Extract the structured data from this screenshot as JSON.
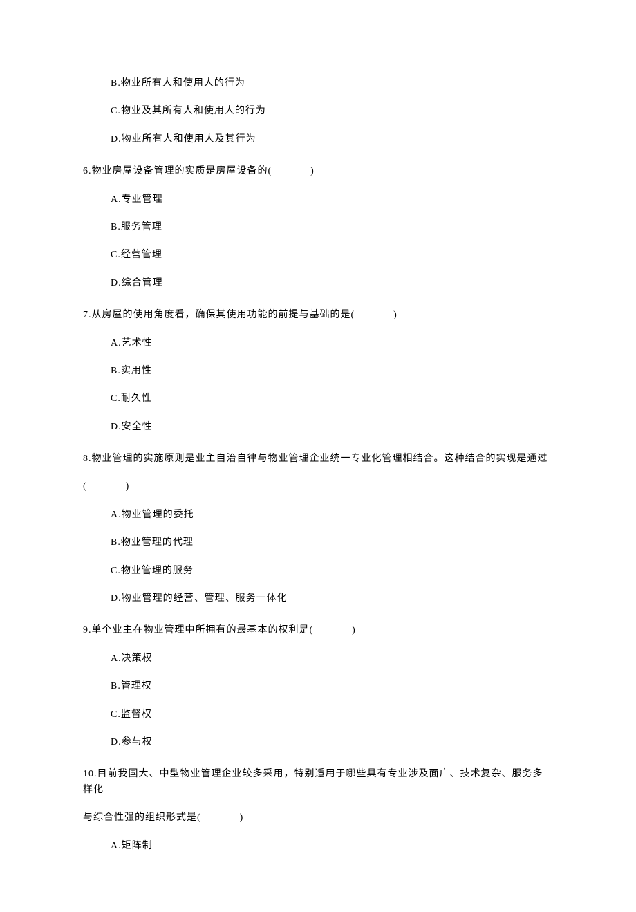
{
  "q5": {
    "options": {
      "b": "B.物业所有人和使用人的行为",
      "c": "C.物业及其所有人和使用人的行为",
      "d": "D.物业所有人和使用人及其行为"
    }
  },
  "q6": {
    "text_pre": "6.物业房屋设备管理的实质是房屋设备的(",
    "text_post": ")",
    "options": {
      "a": "A.专业管理",
      "b": "B.服务管理",
      "c": "C.经营管理",
      "d": "D.综合管理"
    }
  },
  "q7": {
    "text_pre": "7.从房屋的使用角度看，确保其使用功能的前提与基础的是(",
    "text_post": ")",
    "options": {
      "a": "A.艺术性",
      "b": "B.实用性",
      "c": "C.耐久性",
      "d": "D.安全性"
    }
  },
  "q8": {
    "line1": "8.物业管理的实施原则是业主自治自律与物业管理企业统一专业化管理相结合。这种结合的实现是通过",
    "line2_pre": "(",
    "line2_post": ")",
    "options": {
      "a": "A.物业管理的委托",
      "b": "B.物业管理的代理",
      "c": "C.物业管理的服务",
      "d": "D.物业管理的经营、管理、服务一体化"
    }
  },
  "q9": {
    "text_pre": "9.单个业主在物业管理中所拥有的最基本的权利是(",
    "text_post": ")",
    "options": {
      "a": "A.决策权",
      "b": "B.管理权",
      "c": "C.监督权",
      "d": "D.参与权"
    }
  },
  "q10": {
    "line1": "10.目前我国大、中型物业管理企业较多采用，特别适用于哪些具有专业涉及面广、技术复杂、服务多样化",
    "line2_pre": "与综合性强的组织形式是(",
    "line2_post": ")",
    "options": {
      "a": "A.矩阵制"
    }
  }
}
